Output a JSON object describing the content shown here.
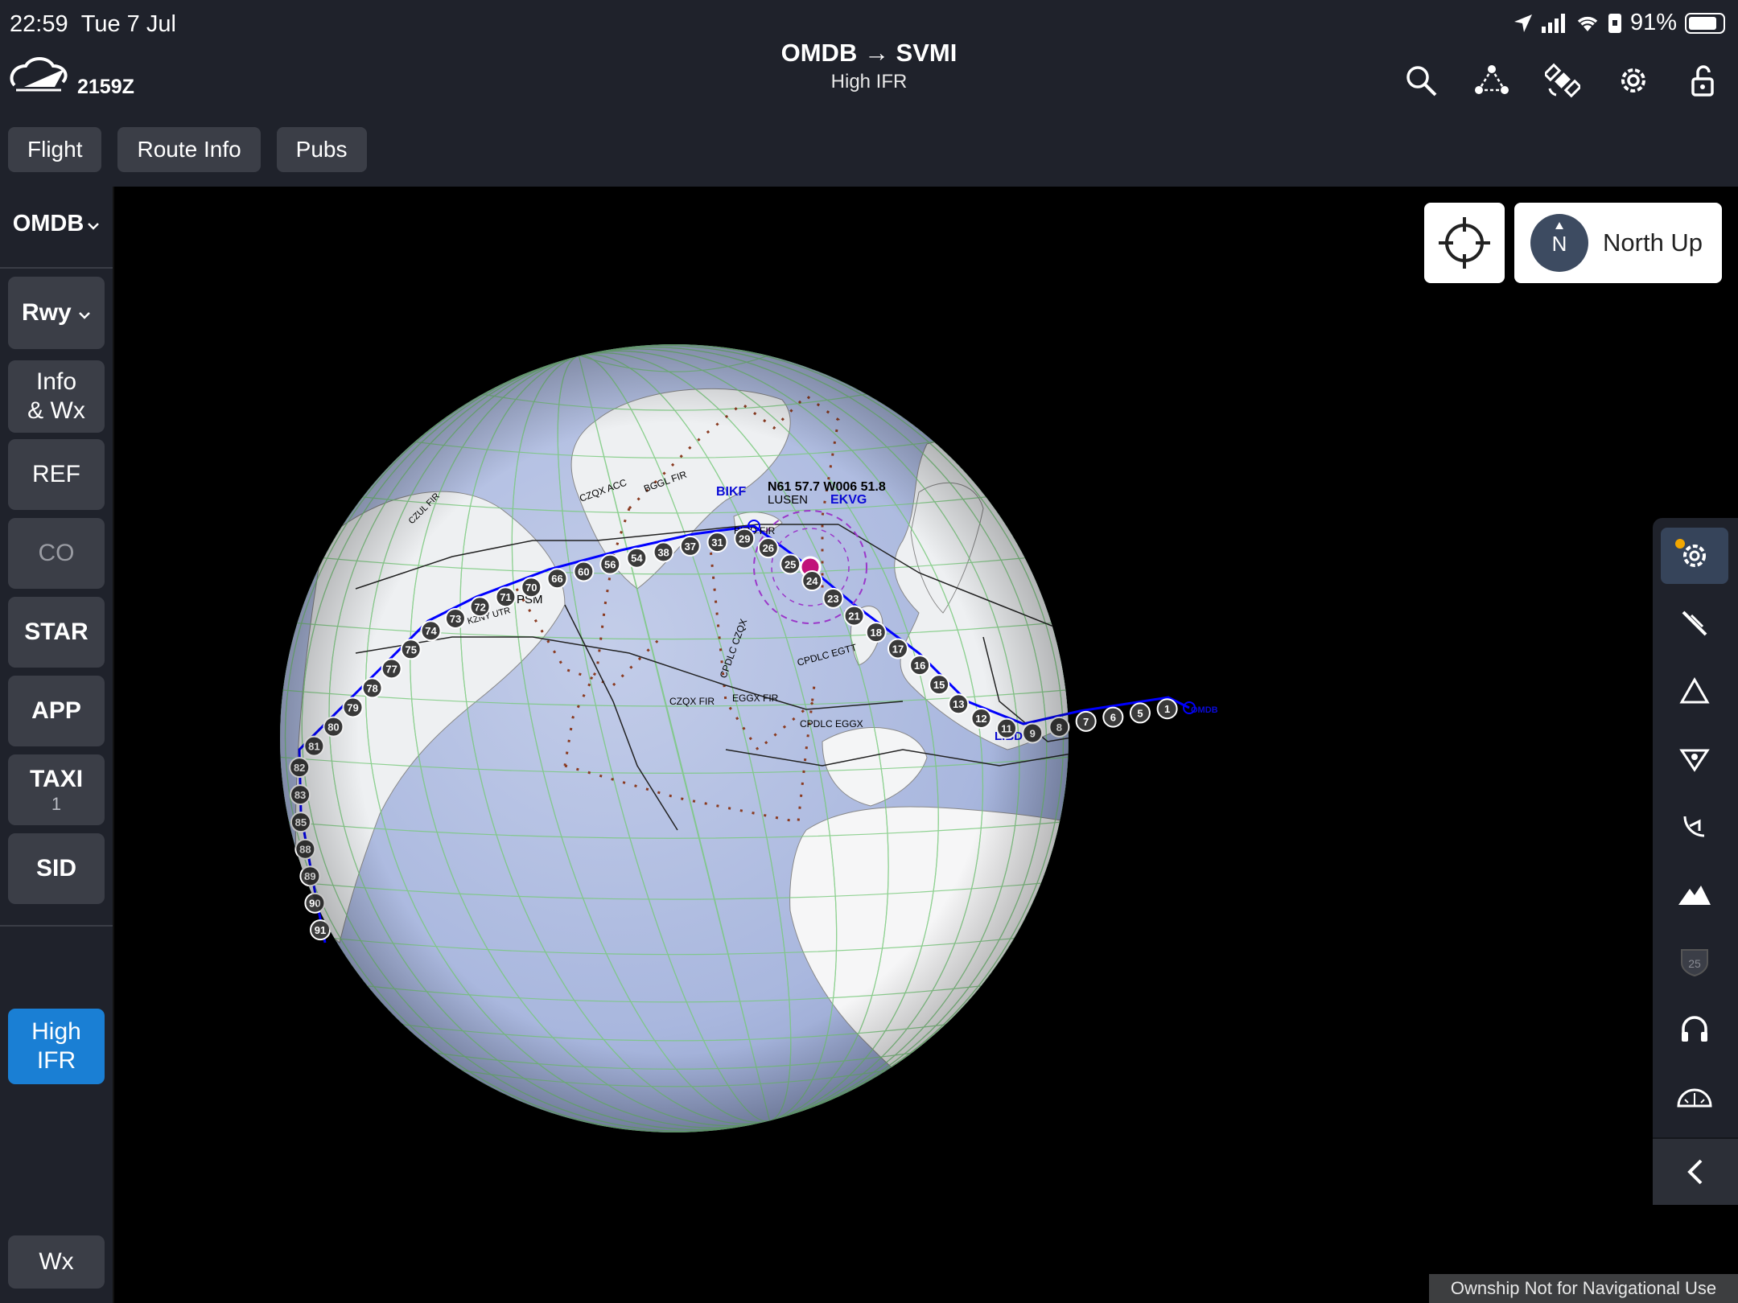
{
  "status": {
    "time": "22:59",
    "date": "Tue 7 Jul",
    "battery": "91%"
  },
  "header": {
    "zulu_time": "2159Z",
    "route": "OMDB → SVMI",
    "chart_type": "High IFR"
  },
  "tabs": [
    "Flight",
    "Route Info",
    "Pubs"
  ],
  "sidebar": {
    "airport": "OMDB",
    "rwy": "Rwy",
    "info_line1": "Info",
    "info_line2": "& Wx",
    "ref": "REF",
    "co": "CO",
    "star": "STAR",
    "app": "APP",
    "taxi": "TAXI",
    "taxi_count": "1",
    "sid": "SID",
    "layer_line1": "High",
    "layer_line2": "IFR",
    "wx": "Wx"
  },
  "map": {
    "north_label": "North Up",
    "compass_letter": "N",
    "position_readout": "N61 57.7 W006 51.8",
    "fix_lusen": "LUSEN",
    "airports": {
      "bikf": "BIKF",
      "ekvg": "EKVG",
      "lirb": "LIBD",
      "omdb": "OMDB",
      "psm": "PSM"
    },
    "fir_labels": [
      "BIRD FIR",
      "CZQX FIR",
      "EGGX FIR",
      "CPDLC EGGX",
      "CPDLC EGTT",
      "CPDLC CZQX",
      "BGGL FIR",
      "CZQX ACC",
      "KZNY UTR",
      "CZUL FIR"
    ],
    "waypoints": [
      "1",
      "5",
      "6",
      "7",
      "8",
      "9",
      "11",
      "12",
      "13",
      "15",
      "16",
      "17",
      "18",
      "21",
      "23",
      "24",
      "25",
      "26",
      "29",
      "31",
      "37",
      "38",
      "54",
      "56",
      "60",
      "66",
      "70",
      "71",
      "72",
      "73",
      "74",
      "75",
      "77",
      "78",
      "79",
      "80",
      "81",
      "82",
      "83",
      "85",
      "88",
      "89",
      "90",
      "91"
    ],
    "disclaimer": "Ownship Not for Navigational Use"
  },
  "icons": {
    "toolbar": [
      "search-icon",
      "route-network-icon",
      "satellite-icon",
      "settings-icon",
      "lock-open-icon"
    ],
    "layers": [
      "settings-layer-icon",
      "airspace-pen-icon",
      "triangle-fix-icon",
      "waypoint-icon",
      "navaid-icon",
      "terrain-icon",
      "shield-25-icon",
      "headphones-icon",
      "protractor-icon"
    ]
  },
  "colors": {
    "route": "#0000ff",
    "active_button": "#1a7fd4",
    "ownship": "#c1127a",
    "grid": "#77c97a",
    "airspace": "#8a3a20"
  }
}
